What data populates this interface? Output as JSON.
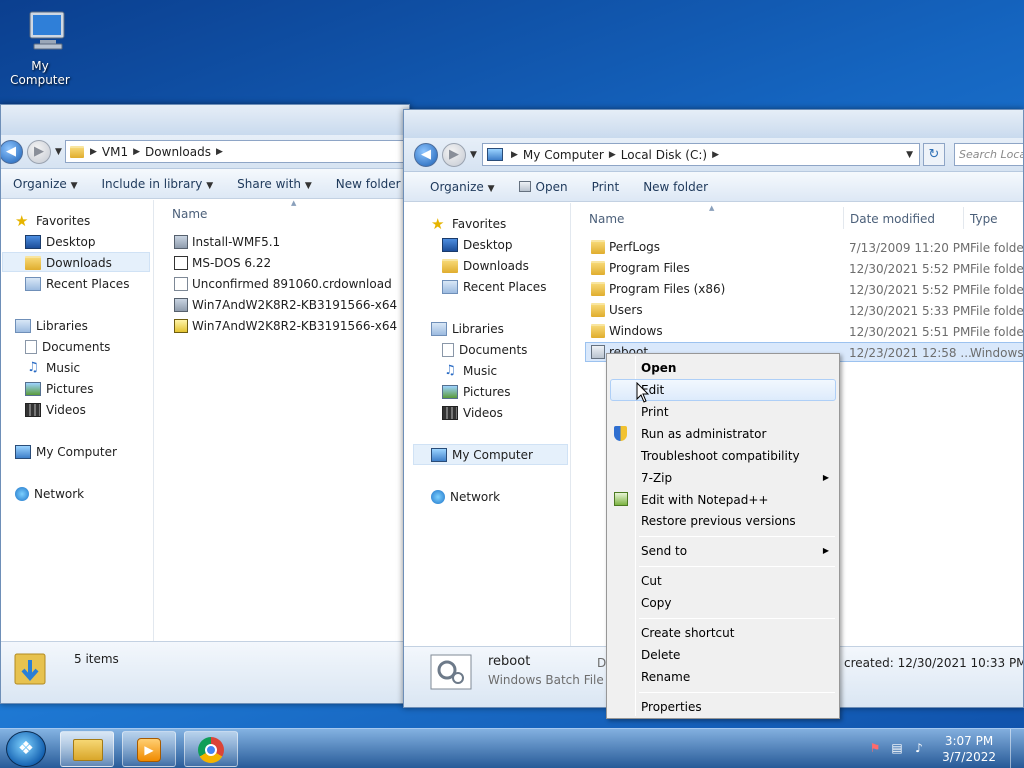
{
  "desktop": {
    "icon_label": "My Computer"
  },
  "win1": {
    "breadcrumb": [
      "VM1",
      "Downloads"
    ],
    "commands": [
      "Organize",
      "Include in library",
      "Share with",
      "New folder"
    ],
    "nav": {
      "favorites": "Favorites",
      "desktop": "Desktop",
      "downloads": "Downloads",
      "recent": "Recent Places",
      "libraries": "Libraries",
      "documents": "Documents",
      "music": "Music",
      "pictures": "Pictures",
      "videos": "Videos",
      "computer": "My Computer",
      "network": "Network"
    },
    "col_name": "Name",
    "files": [
      "Install-WMF5.1",
      "MS-DOS 6.22",
      "Unconfirmed 891060.crdownload",
      "Win7AndW2K8R2-KB3191566-x64",
      "Win7AndW2K8R2-KB3191566-x64"
    ],
    "status": "5 items"
  },
  "win2": {
    "breadcrumb": [
      "My Computer",
      "Local Disk (C:)"
    ],
    "search_placeholder": "Search Local Disk (C:)",
    "commands": [
      "Organize",
      "Open",
      "Print",
      "New folder"
    ],
    "nav": {
      "favorites": "Favorites",
      "desktop": "Desktop",
      "downloads": "Downloads",
      "recent": "Recent Places",
      "libraries": "Libraries",
      "documents": "Documents",
      "music": "Music",
      "pictures": "Pictures",
      "videos": "Videos",
      "computer": "My Computer",
      "network": "Network"
    },
    "columns": {
      "name": "Name",
      "date": "Date modified",
      "type": "Type"
    },
    "rows": [
      {
        "name": "PerfLogs",
        "date": "7/13/2009 11:20 PM",
        "type": "File folder"
      },
      {
        "name": "Program Files",
        "date": "12/30/2021 5:52 PM",
        "type": "File folder"
      },
      {
        "name": "Program Files (x86)",
        "date": "12/30/2021 5:52 PM",
        "type": "File folder"
      },
      {
        "name": "Users",
        "date": "12/30/2021 5:33 PM",
        "type": "File folder"
      },
      {
        "name": "Windows",
        "date": "12/30/2021 5:51 PM",
        "type": "File folder"
      },
      {
        "name": "reboot",
        "date": "12/23/2021 12:58 ...",
        "type": "Windows B"
      }
    ],
    "details": {
      "name": "reboot",
      "type": "Windows Batch File",
      "d_prefix": "D",
      "created": "created: 12/30/2021 10:33 PM"
    }
  },
  "context_menu": {
    "open": "Open",
    "edit": "Edit",
    "print": "Print",
    "run_admin": "Run as administrator",
    "troubleshoot": "Troubleshoot compatibility",
    "zip": "7-Zip",
    "notepad": "Edit with Notepad++",
    "restore": "Restore previous versions",
    "send_to": "Send to",
    "cut": "Cut",
    "copy": "Copy",
    "shortcut": "Create shortcut",
    "delete": "Delete",
    "rename": "Rename",
    "properties": "Properties"
  },
  "taskbar": {
    "time": "3:07 PM",
    "date": "3/7/2022"
  }
}
